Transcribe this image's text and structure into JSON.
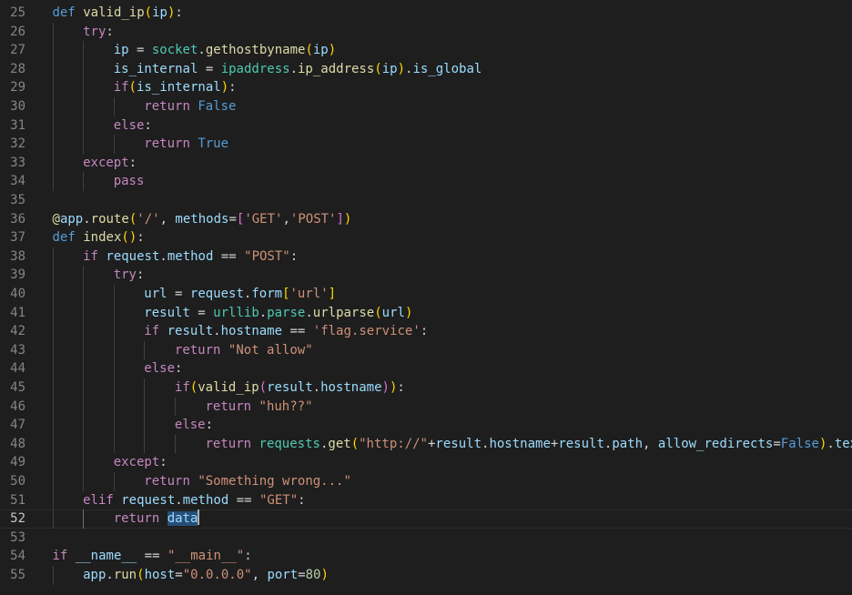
{
  "editor": {
    "language": "python",
    "cursor_line": 52,
    "lines": [
      {
        "n": "25",
        "indent": 0,
        "tokens": [
          {
            "t": "def",
            "c": "kw"
          },
          {
            "t": " "
          },
          {
            "t": "valid_ip",
            "c": "fn"
          },
          {
            "t": "(",
            "c": "br1"
          },
          {
            "t": "ip",
            "c": "var"
          },
          {
            "t": ")",
            "c": "br1"
          },
          {
            "t": ":"
          }
        ]
      },
      {
        "n": "26",
        "indent": 1,
        "tokens": [
          {
            "t": "try",
            "c": "ctl"
          },
          {
            "t": ":"
          }
        ]
      },
      {
        "n": "27",
        "indent": 2,
        "tokens": [
          {
            "t": "ip",
            "c": "var"
          },
          {
            "t": " = "
          },
          {
            "t": "socket",
            "c": "cls"
          },
          {
            "t": "."
          },
          {
            "t": "gethostbyname",
            "c": "fn"
          },
          {
            "t": "(",
            "c": "br1"
          },
          {
            "t": "ip",
            "c": "var"
          },
          {
            "t": ")",
            "c": "br1"
          }
        ]
      },
      {
        "n": "28",
        "indent": 2,
        "tokens": [
          {
            "t": "is_internal",
            "c": "var"
          },
          {
            "t": " = "
          },
          {
            "t": "ipaddress",
            "c": "cls"
          },
          {
            "t": "."
          },
          {
            "t": "ip_address",
            "c": "fn"
          },
          {
            "t": "(",
            "c": "br1"
          },
          {
            "t": "ip",
            "c": "var"
          },
          {
            "t": ")",
            "c": "br1"
          },
          {
            "t": "."
          },
          {
            "t": "is_global",
            "c": "var"
          }
        ]
      },
      {
        "n": "29",
        "indent": 2,
        "tokens": [
          {
            "t": "if",
            "c": "ctl"
          },
          {
            "t": "(",
            "c": "br1"
          },
          {
            "t": "is_internal",
            "c": "var"
          },
          {
            "t": ")",
            "c": "br1"
          },
          {
            "t": ":"
          }
        ]
      },
      {
        "n": "30",
        "indent": 3,
        "tokens": [
          {
            "t": "return",
            "c": "ctl"
          },
          {
            "t": " "
          },
          {
            "t": "False",
            "c": "kw"
          }
        ]
      },
      {
        "n": "31",
        "indent": 2,
        "tokens": [
          {
            "t": "else",
            "c": "ctl"
          },
          {
            "t": ":"
          }
        ]
      },
      {
        "n": "32",
        "indent": 3,
        "tokens": [
          {
            "t": "return",
            "c": "ctl"
          },
          {
            "t": " "
          },
          {
            "t": "True",
            "c": "kw"
          }
        ]
      },
      {
        "n": "33",
        "indent": 1,
        "tokens": [
          {
            "t": "except",
            "c": "ctl"
          },
          {
            "t": ":"
          }
        ]
      },
      {
        "n": "34",
        "indent": 2,
        "tokens": [
          {
            "t": "pass",
            "c": "ctl"
          }
        ]
      },
      {
        "n": "35",
        "indent": 0,
        "tokens": []
      },
      {
        "n": "36",
        "indent": 0,
        "tokens": [
          {
            "t": "@",
            "c": "fn"
          },
          {
            "t": "app",
            "c": "var"
          },
          {
            "t": "."
          },
          {
            "t": "route",
            "c": "fn"
          },
          {
            "t": "(",
            "c": "br1"
          },
          {
            "t": "'/'",
            "c": "str"
          },
          {
            "t": ", "
          },
          {
            "t": "methods",
            "c": "var"
          },
          {
            "t": "="
          },
          {
            "t": "[",
            "c": "br2"
          },
          {
            "t": "'GET'",
            "c": "str"
          },
          {
            "t": ","
          },
          {
            "t": "'POST'",
            "c": "str"
          },
          {
            "t": "]",
            "c": "br2"
          },
          {
            "t": ")",
            "c": "br1"
          }
        ]
      },
      {
        "n": "37",
        "indent": 0,
        "tokens": [
          {
            "t": "def",
            "c": "kw"
          },
          {
            "t": " "
          },
          {
            "t": "index",
            "c": "fn"
          },
          {
            "t": "()",
            "c": "br1"
          },
          {
            "t": ":"
          }
        ]
      },
      {
        "n": "38",
        "indent": 1,
        "tokens": [
          {
            "t": "if",
            "c": "ctl"
          },
          {
            "t": " "
          },
          {
            "t": "request",
            "c": "var"
          },
          {
            "t": "."
          },
          {
            "t": "method",
            "c": "var"
          },
          {
            "t": " == "
          },
          {
            "t": "\"POST\"",
            "c": "str"
          },
          {
            "t": ":"
          }
        ]
      },
      {
        "n": "39",
        "indent": 2,
        "tokens": [
          {
            "t": "try",
            "c": "ctl"
          },
          {
            "t": ":"
          }
        ]
      },
      {
        "n": "40",
        "indent": 3,
        "tokens": [
          {
            "t": "url",
            "c": "var"
          },
          {
            "t": " = "
          },
          {
            "t": "request",
            "c": "var"
          },
          {
            "t": "."
          },
          {
            "t": "form",
            "c": "var"
          },
          {
            "t": "[",
            "c": "br1"
          },
          {
            "t": "'url'",
            "c": "str"
          },
          {
            "t": "]",
            "c": "br1"
          }
        ]
      },
      {
        "n": "41",
        "indent": 3,
        "tokens": [
          {
            "t": "result",
            "c": "var"
          },
          {
            "t": " = "
          },
          {
            "t": "urllib",
            "c": "cls"
          },
          {
            "t": "."
          },
          {
            "t": "parse",
            "c": "cls"
          },
          {
            "t": "."
          },
          {
            "t": "urlparse",
            "c": "fn"
          },
          {
            "t": "(",
            "c": "br1"
          },
          {
            "t": "url",
            "c": "var"
          },
          {
            "t": ")",
            "c": "br1"
          }
        ]
      },
      {
        "n": "42",
        "indent": 3,
        "tokens": [
          {
            "t": "if",
            "c": "ctl"
          },
          {
            "t": " "
          },
          {
            "t": "result",
            "c": "var"
          },
          {
            "t": "."
          },
          {
            "t": "hostname",
            "c": "var"
          },
          {
            "t": " == "
          },
          {
            "t": "'flag.service'",
            "c": "str"
          },
          {
            "t": ":"
          }
        ]
      },
      {
        "n": "43",
        "indent": 4,
        "tokens": [
          {
            "t": "return",
            "c": "ctl"
          },
          {
            "t": " "
          },
          {
            "t": "\"Not allow\"",
            "c": "str"
          }
        ]
      },
      {
        "n": "44",
        "indent": 3,
        "tokens": [
          {
            "t": "else",
            "c": "ctl"
          },
          {
            "t": ":"
          }
        ]
      },
      {
        "n": "45",
        "indent": 4,
        "tokens": [
          {
            "t": "if",
            "c": "ctl"
          },
          {
            "t": "(",
            "c": "br1"
          },
          {
            "t": "valid_ip",
            "c": "fn"
          },
          {
            "t": "(",
            "c": "br2"
          },
          {
            "t": "result",
            "c": "var"
          },
          {
            "t": "."
          },
          {
            "t": "hostname",
            "c": "var"
          },
          {
            "t": ")",
            "c": "br2"
          },
          {
            "t": ")",
            "c": "br1"
          },
          {
            "t": ":"
          }
        ]
      },
      {
        "n": "46",
        "indent": 5,
        "tokens": [
          {
            "t": "return",
            "c": "ctl"
          },
          {
            "t": " "
          },
          {
            "t": "\"huh??\"",
            "c": "str"
          }
        ]
      },
      {
        "n": "47",
        "indent": 4,
        "tokens": [
          {
            "t": "else",
            "c": "ctl"
          },
          {
            "t": ":"
          }
        ]
      },
      {
        "n": "48",
        "indent": 5,
        "tokens": [
          {
            "t": "return",
            "c": "ctl"
          },
          {
            "t": " "
          },
          {
            "t": "requests",
            "c": "cls"
          },
          {
            "t": "."
          },
          {
            "t": "get",
            "c": "fn"
          },
          {
            "t": "(",
            "c": "br1"
          },
          {
            "t": "\"http://\"",
            "c": "str"
          },
          {
            "t": "+"
          },
          {
            "t": "result",
            "c": "var"
          },
          {
            "t": "."
          },
          {
            "t": "hostname",
            "c": "var"
          },
          {
            "t": "+"
          },
          {
            "t": "result",
            "c": "var"
          },
          {
            "t": "."
          },
          {
            "t": "path",
            "c": "var"
          },
          {
            "t": ", "
          },
          {
            "t": "allow_redirects",
            "c": "var"
          },
          {
            "t": "="
          },
          {
            "t": "False",
            "c": "kw"
          },
          {
            "t": ")",
            "c": "br1"
          },
          {
            "t": "."
          },
          {
            "t": "text",
            "c": "var"
          }
        ]
      },
      {
        "n": "49",
        "indent": 2,
        "tokens": [
          {
            "t": "except",
            "c": "ctl"
          },
          {
            "t": ":"
          }
        ]
      },
      {
        "n": "50",
        "indent": 3,
        "tokens": [
          {
            "t": "return",
            "c": "ctl"
          },
          {
            "t": " "
          },
          {
            "t": "\"Something wrong...\"",
            "c": "str"
          }
        ]
      },
      {
        "n": "51",
        "indent": 1,
        "tokens": [
          {
            "t": "elif",
            "c": "ctl"
          },
          {
            "t": " "
          },
          {
            "t": "request",
            "c": "var"
          },
          {
            "t": "."
          },
          {
            "t": "method",
            "c": "var"
          },
          {
            "t": " == "
          },
          {
            "t": "\"GET\"",
            "c": "str"
          },
          {
            "t": ":"
          }
        ]
      },
      {
        "n": "52",
        "indent": 2,
        "tokens": [
          {
            "t": "return",
            "c": "ctl"
          },
          {
            "t": " "
          },
          {
            "t": "data",
            "c": "var",
            "hl": true
          }
        ]
      },
      {
        "n": "53",
        "indent": 0,
        "tokens": []
      },
      {
        "n": "54",
        "indent": 0,
        "tokens": [
          {
            "t": "if",
            "c": "ctl"
          },
          {
            "t": " "
          },
          {
            "t": "__name__",
            "c": "var"
          },
          {
            "t": " == "
          },
          {
            "t": "\"__main__\"",
            "c": "str"
          },
          {
            "t": ":"
          }
        ]
      },
      {
        "n": "55",
        "indent": 1,
        "tokens": [
          {
            "t": "app",
            "c": "var"
          },
          {
            "t": "."
          },
          {
            "t": "run",
            "c": "fn"
          },
          {
            "t": "(",
            "c": "br1"
          },
          {
            "t": "host",
            "c": "var"
          },
          {
            "t": "="
          },
          {
            "t": "\"0.0.0.0\"",
            "c": "str"
          },
          {
            "t": ", "
          },
          {
            "t": "port",
            "c": "var"
          },
          {
            "t": "="
          },
          {
            "t": "80",
            "c": "num"
          },
          {
            "t": ")",
            "c": "br1"
          }
        ]
      }
    ]
  }
}
